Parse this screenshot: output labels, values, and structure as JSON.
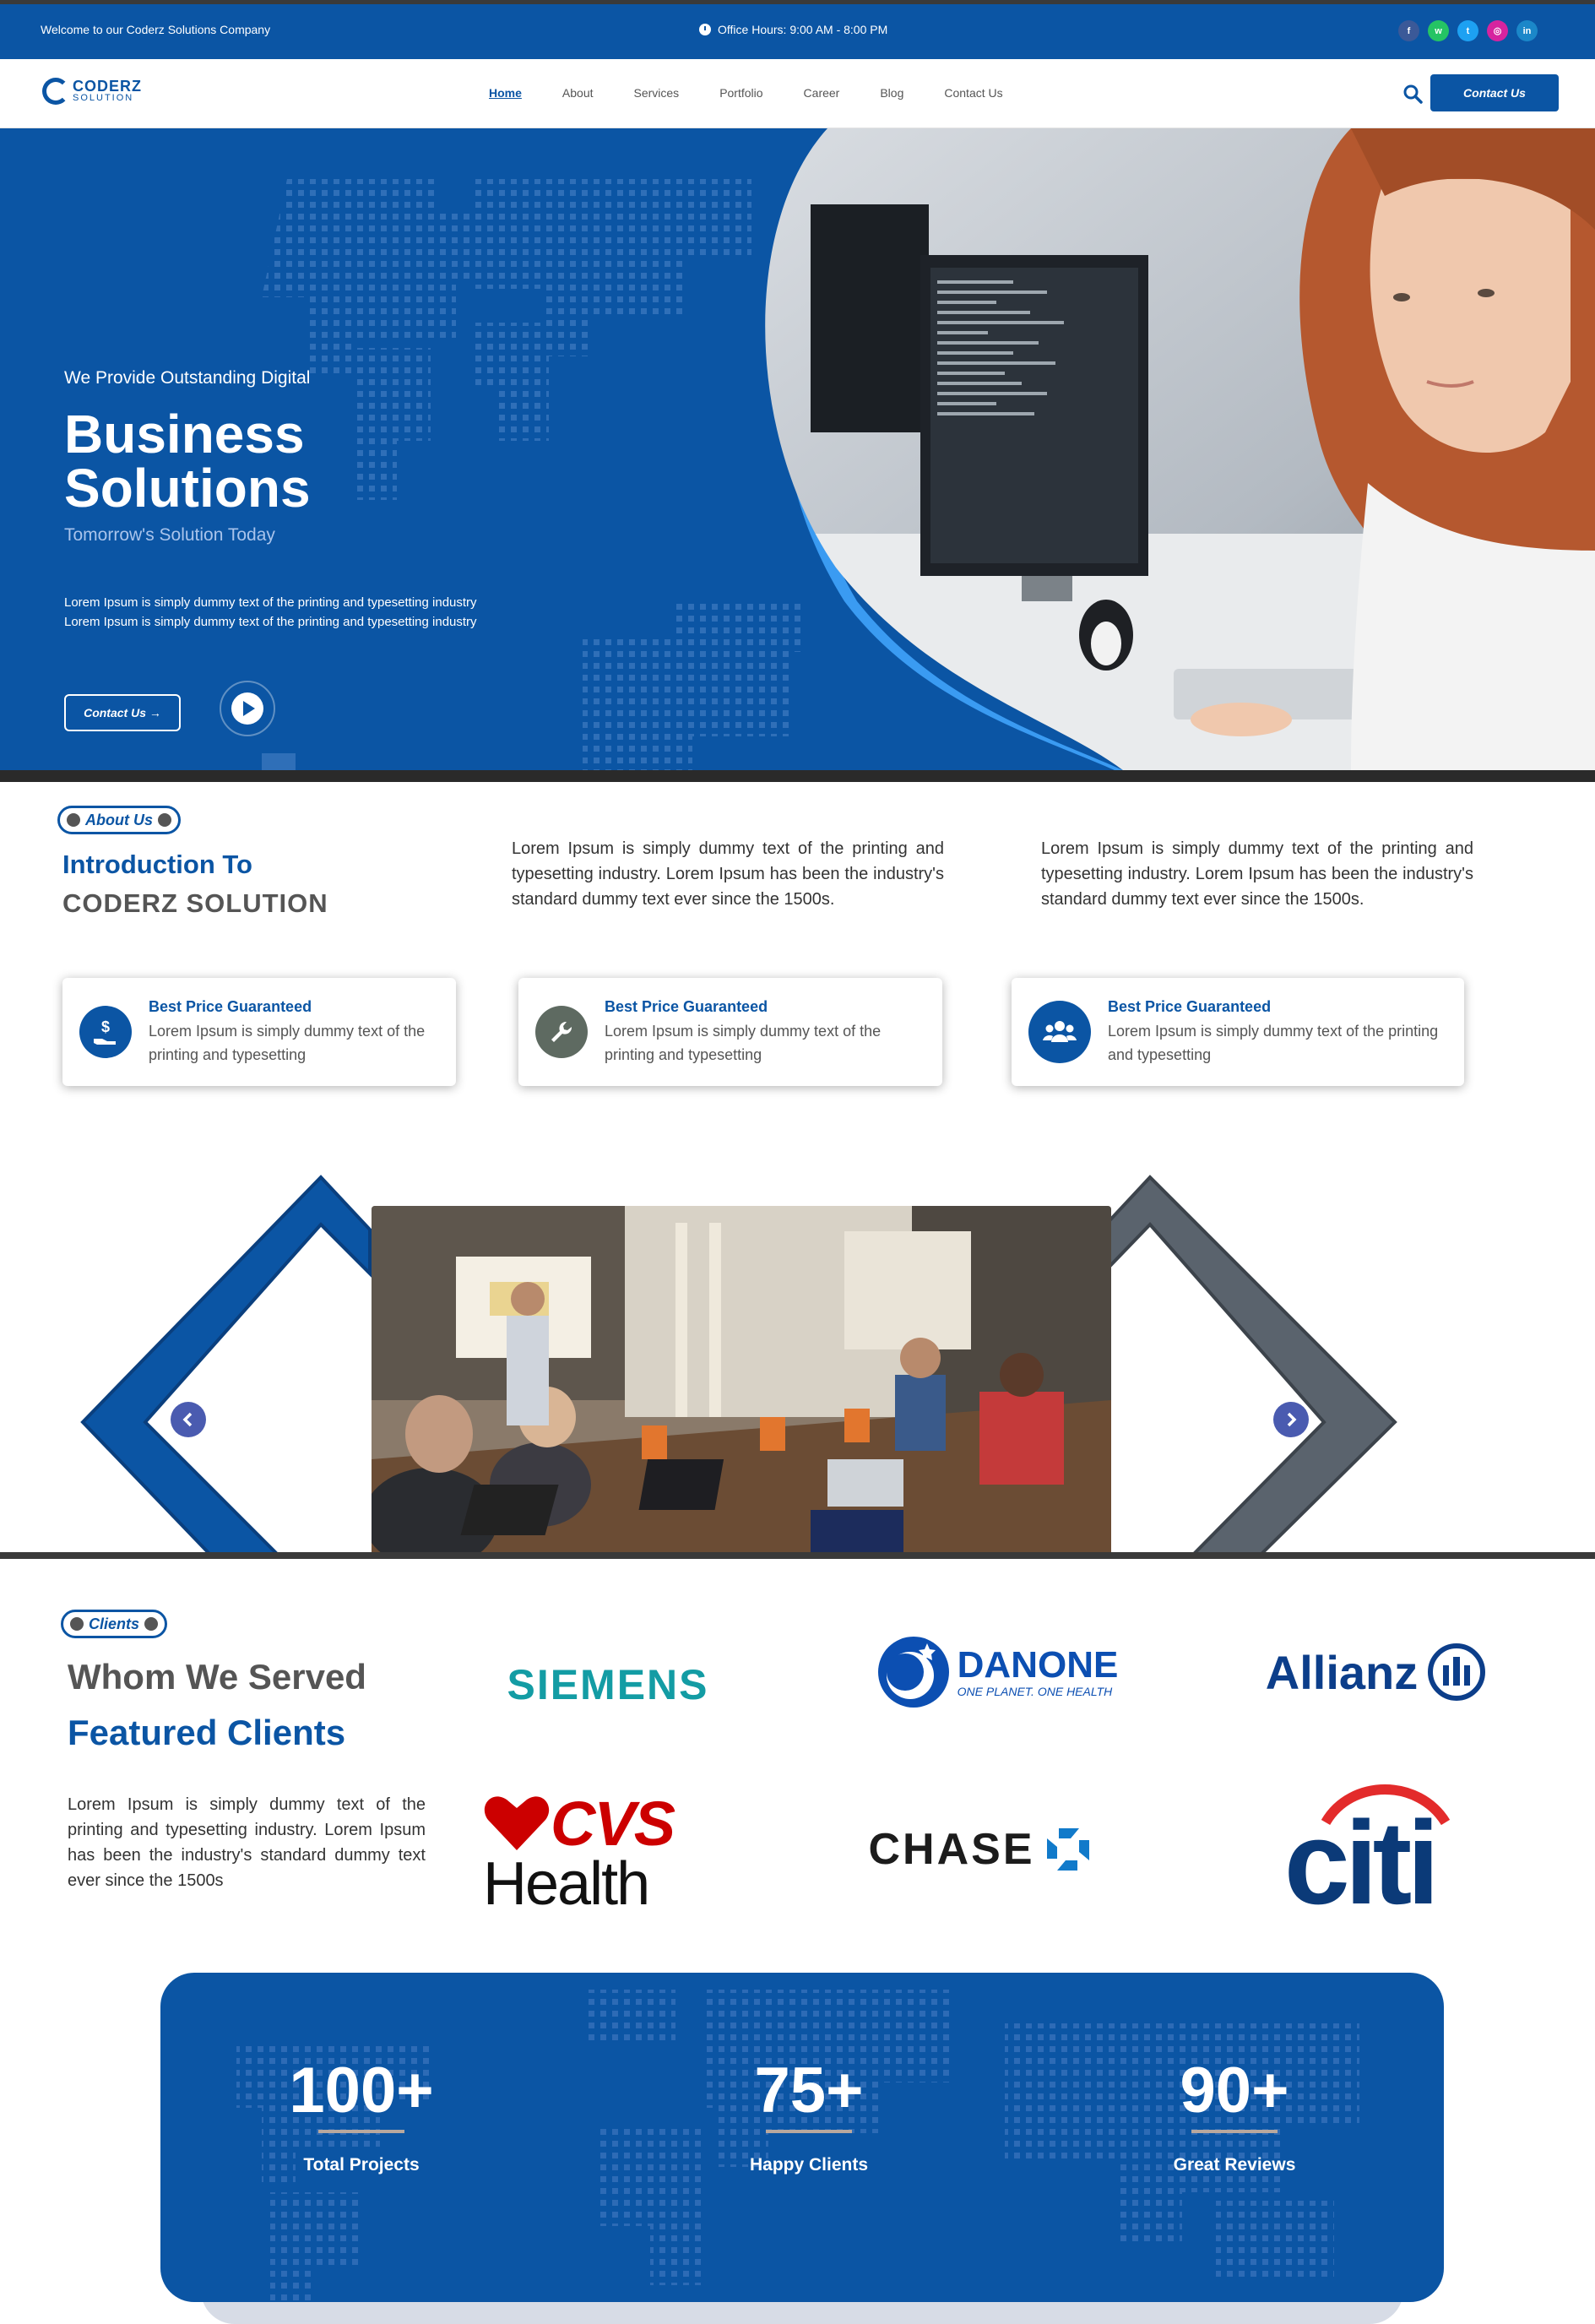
{
  "topbar": {
    "welcome": "Welcome to our Coderz Solutions Company",
    "office_hours": "Office Hours: 9:00 AM - 8:00 PM",
    "socials": [
      {
        "name": "facebook",
        "glyph": "f",
        "color": "#3b5998"
      },
      {
        "name": "whatsapp",
        "glyph": "w",
        "color": "#25c464"
      },
      {
        "name": "twitter",
        "glyph": "t",
        "color": "#1da1f2"
      },
      {
        "name": "instagram",
        "glyph": "◎",
        "color": "#d6249f"
      },
      {
        "name": "linkedin",
        "glyph": "in",
        "color": "#1b87c9"
      }
    ]
  },
  "nav": {
    "logo_top": "CODERZ",
    "logo_bottom": "SOLUTION",
    "items": [
      "Home",
      "About",
      "Services",
      "Portfolio",
      "Career",
      "Blog",
      "Contact Us"
    ],
    "active": "Home",
    "cta": "Contact Us"
  },
  "hero": {
    "pre": "We Provide Outstanding Digital",
    "title_line1": "Business",
    "title_line2": "Solutions",
    "tagline": "Tomorrow's Solution Today",
    "desc_line1": "Lorem Ipsum is simply dummy text of the printing and typesetting industry",
    "desc_line2": "Lorem Ipsum is simply dummy text of the printing and typesetting industry",
    "cta": "Contact Us →"
  },
  "about": {
    "pill": "About Us",
    "heading1": "Introduction To",
    "heading2": "CODERZ SOLUTION",
    "para1": "Lorem Ipsum is simply dummy text of the printing and typesetting industry. Lorem Ipsum has been the industry's standard dummy text ever since the 1500s.",
    "para2": "Lorem Ipsum is simply dummy text of the printing and typesetting industry. Lorem Ipsum has been the industry's standard dummy text ever since the 1500s.",
    "features": [
      {
        "title": "Best Price Guaranteed",
        "desc": "Lorem Ipsum is simply dummy text of the printing and typesetting",
        "icon": "hand-dollar-icon",
        "color": "#0b55a4"
      },
      {
        "title": "Best Price Guaranteed",
        "desc": "Lorem Ipsum is simply dummy text of the printing and typesetting",
        "icon": "wrench-icon",
        "color": "#5e6a61"
      },
      {
        "title": "Best Price Guaranteed",
        "desc": "Lorem Ipsum is simply dummy text of the printing and typesetting",
        "icon": "users-icon",
        "color": "#0b55a4"
      }
    ]
  },
  "clients": {
    "pill": "Clients",
    "heading1": "Whom We Served",
    "heading2": "Featured Clients",
    "para": "Lorem Ipsum is simply dummy text of the printing and typesetting industry. Lorem Ipsum has been the industry's standard dummy text ever since the 1500s",
    "logos": {
      "siemens": "SIEMENS",
      "danone": "DANONE",
      "danone_tag": "ONE PLANET. ONE HEALTH",
      "allianz": "Allianz",
      "cvs": "CVS",
      "health": "Health",
      "chase": "CHASE",
      "citi": "citi"
    }
  },
  "stats": [
    {
      "value": "100+",
      "label": "Total Projects"
    },
    {
      "value": "75+",
      "label": "Happy Clients"
    },
    {
      "value": "90+",
      "label": "Great Reviews"
    }
  ],
  "colors": {
    "brand": "#0b55a4",
    "accent": "#3a9bf2"
  }
}
